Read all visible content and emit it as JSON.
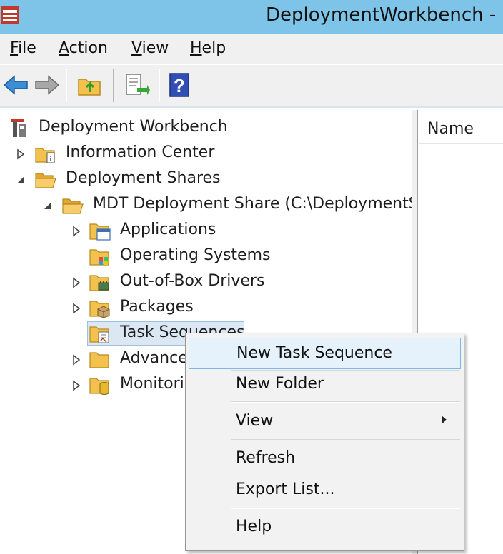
{
  "window": {
    "title": "DeploymentWorkbench -"
  },
  "menubar": {
    "items": [
      {
        "label": "File",
        "mnemonic": "F",
        "rest": "ile"
      },
      {
        "label": "Action",
        "mnemonic": "A",
        "rest": "ction"
      },
      {
        "label": "View",
        "mnemonic": "V",
        "rest": "iew"
      },
      {
        "label": "Help",
        "mnemonic": "H",
        "rest": "elp"
      }
    ]
  },
  "toolbar": {
    "buttons": [
      "back-arrow-icon",
      "forward-arrow-icon",
      "up-folder-icon",
      "export-list-icon",
      "help-icon"
    ]
  },
  "tree": {
    "root": "Deployment Workbench",
    "information_center": "Information Center",
    "deployment_shares": "Deployment Shares",
    "mdt_share": "MDT Deployment Share (C:\\DeploymentS",
    "applications": "Applications",
    "operating_systems": "Operating Systems",
    "drivers": "Out-of-Box Drivers",
    "packages": "Packages",
    "task_sequences": "Task Sequences",
    "advanced": "Advance",
    "monitoring": "Monitori"
  },
  "list": {
    "column_name": "Name"
  },
  "context_menu": {
    "new_task_sequence": "New Task Sequence",
    "new_folder": "New Folder",
    "view": "View",
    "refresh": "Refresh",
    "export_list": "Export List...",
    "help": "Help"
  },
  "colors": {
    "titlebar": "#7ec4e8",
    "folder": "#f2c14e",
    "highlight": "#e5f1fb",
    "highlight_border": "#79b8e4"
  }
}
